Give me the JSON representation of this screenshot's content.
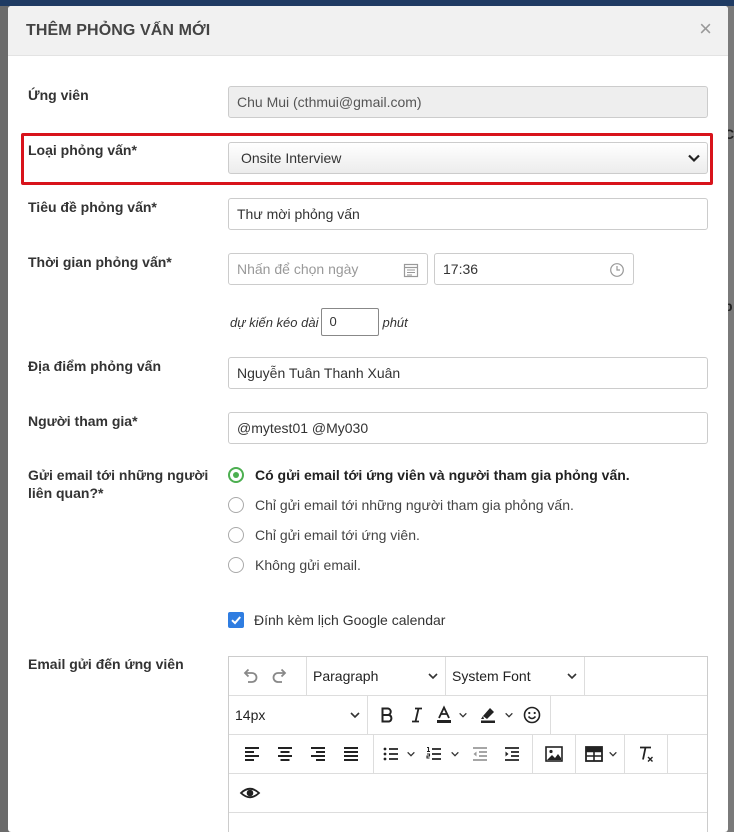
{
  "modal": {
    "title": "THÊM PHỎNG VẤN MỚI",
    "close": "×"
  },
  "candidate": {
    "label": "Ứng viên",
    "value": "Chu Mui (cthmui@gmail.com)"
  },
  "interview_type": {
    "label": "Loại phỏng vấn*",
    "value": "Onsite Interview"
  },
  "interview_title": {
    "label": "Tiêu đề phỏng vấn*",
    "value": "Thư mời phỏng vấn"
  },
  "interview_time": {
    "label": "Thời gian phỏng vấn*",
    "date_placeholder": "Nhấn để chọn ngày",
    "time_value": "17:36",
    "duration_prefix": "dự kiến kéo dài",
    "duration_value": "0",
    "duration_unit": "phút"
  },
  "location": {
    "label": "Địa điểm phỏng vấn",
    "value": "Nguyễn Tuân Thanh Xuân"
  },
  "participants": {
    "label": "Người tham gia*",
    "value": "@mytest01 @My030"
  },
  "email_option": {
    "label": "Gửi email tới những người liên quan?*",
    "options": [
      "Có gửi email tới ứng viên và người tham gia phỏng vấn.",
      "Chỉ gửi email tới những người tham gia phỏng vấn.",
      "Chỉ gửi email tới ứng viên.",
      "Không gửi email."
    ],
    "selected_index": 0
  },
  "calendar": {
    "label": "Đính kèm lịch Google calendar",
    "checked": true
  },
  "candidate_email": {
    "label": "Email gửi đến ứng viên",
    "toolbar": {
      "block_format": "Paragraph",
      "font_family": "System Font",
      "font_size": "14px"
    }
  },
  "colors": {
    "accent_green": "#4caf50",
    "checkbox_blue": "#2f7de1",
    "highlight_red": "#d8131b"
  },
  "backdrop": {
    "fragment_1": "C",
    "fragment_2": "b"
  }
}
